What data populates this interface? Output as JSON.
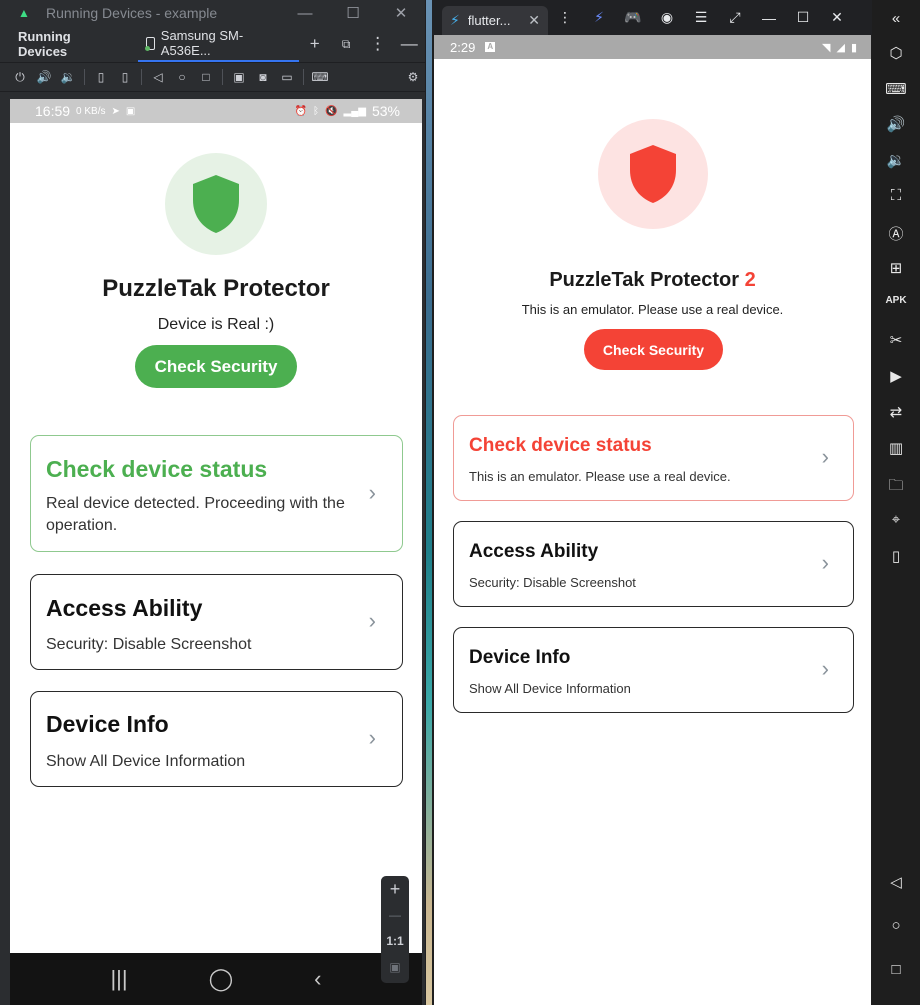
{
  "left_window": {
    "title": "Running Devices - example",
    "tool_title": "Running Devices",
    "device_tab": "Samsung SM-A536E...",
    "zoom": {
      "plus": "+",
      "minus": "—",
      "ratio": "1:1"
    }
  },
  "left_phone": {
    "status": {
      "time": "16:59",
      "speed": "0 KB/s",
      "battery": "53%"
    },
    "app_title": "PuzzleTak Protector",
    "subtitle": "Device is Real :)",
    "button_label": "Check Security",
    "cards": [
      {
        "title": "Check device status",
        "desc": "Real device detected. Proceeding with the operation."
      },
      {
        "title": "Access Ability",
        "desc": "Security: Disable Screenshot"
      },
      {
        "title": "Device Info",
        "desc": "Show All Device Information"
      }
    ]
  },
  "right_window": {
    "tab_title": "flutter...",
    "status": {
      "time": "2:29",
      "badge": "A"
    }
  },
  "right_phone": {
    "app_title": "PuzzleTak Protector",
    "app_title_suffix": "2",
    "subtitle": "This is an emulator. Please use a real device.",
    "button_label": "Check Security",
    "cards": [
      {
        "title": "Check device status",
        "desc": "This is an emulator. Please use a real device."
      },
      {
        "title": "Access Ability",
        "desc": "Security: Disable Screenshot"
      },
      {
        "title": "Device Info",
        "desc": "Show All Device Information"
      }
    ]
  },
  "colors": {
    "green_accent": "#4caf50",
    "green_circle": "#e6f2e5",
    "red_accent": "#f44336",
    "red_circle": "#fde3e2"
  }
}
